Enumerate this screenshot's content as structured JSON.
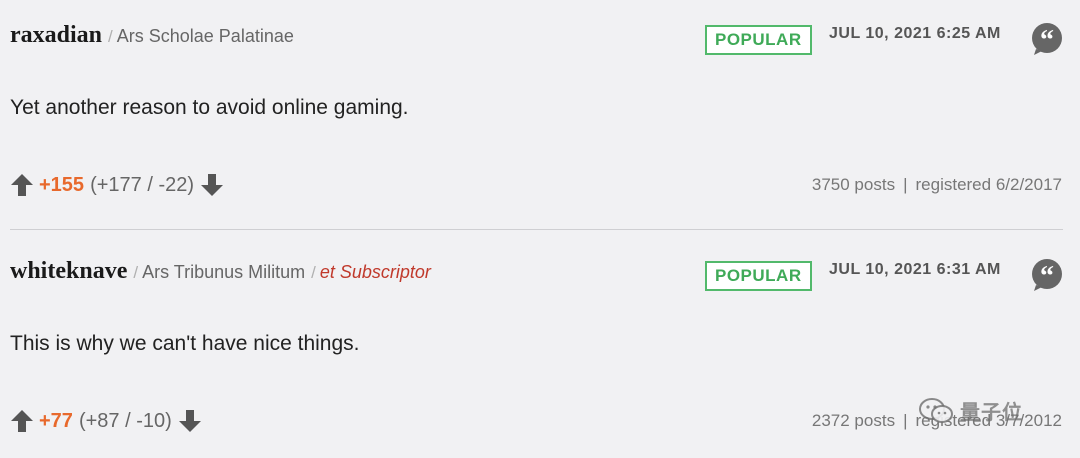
{
  "comments": [
    {
      "username": "raxadian",
      "rank": "Ars Scholae Palatinae",
      "subscriptor": "",
      "badge": "POPULAR",
      "date": "JUL 10, 2021 6:25 AM",
      "body": "Yet another reason to avoid online gaming.",
      "score": "+155",
      "breakdown": "(+177 / -22)",
      "posts": "3750 posts",
      "registered": "registered 6/2/2017"
    },
    {
      "username": "whiteknave",
      "rank": "Ars Tribunus Militum",
      "subscriptor": "et Subscriptor",
      "badge": "POPULAR",
      "date": "JUL 10, 2021 6:31 AM",
      "body": "This is why we can't have nice things.",
      "score": "+77",
      "breakdown": "(+87 / -10)",
      "posts": "2372 posts",
      "registered": "registered 3/7/2012"
    }
  ],
  "separators": {
    "slash": "/",
    "bar": "|"
  },
  "watermark": {
    "text": "量子位",
    "icon": "wechat-icon"
  },
  "colors": {
    "background": "#f1f1f3",
    "score": "#e8692c",
    "badge_green": "#52b96b",
    "subscriptor_red": "#c0392b",
    "icon_gray": "#666666"
  }
}
